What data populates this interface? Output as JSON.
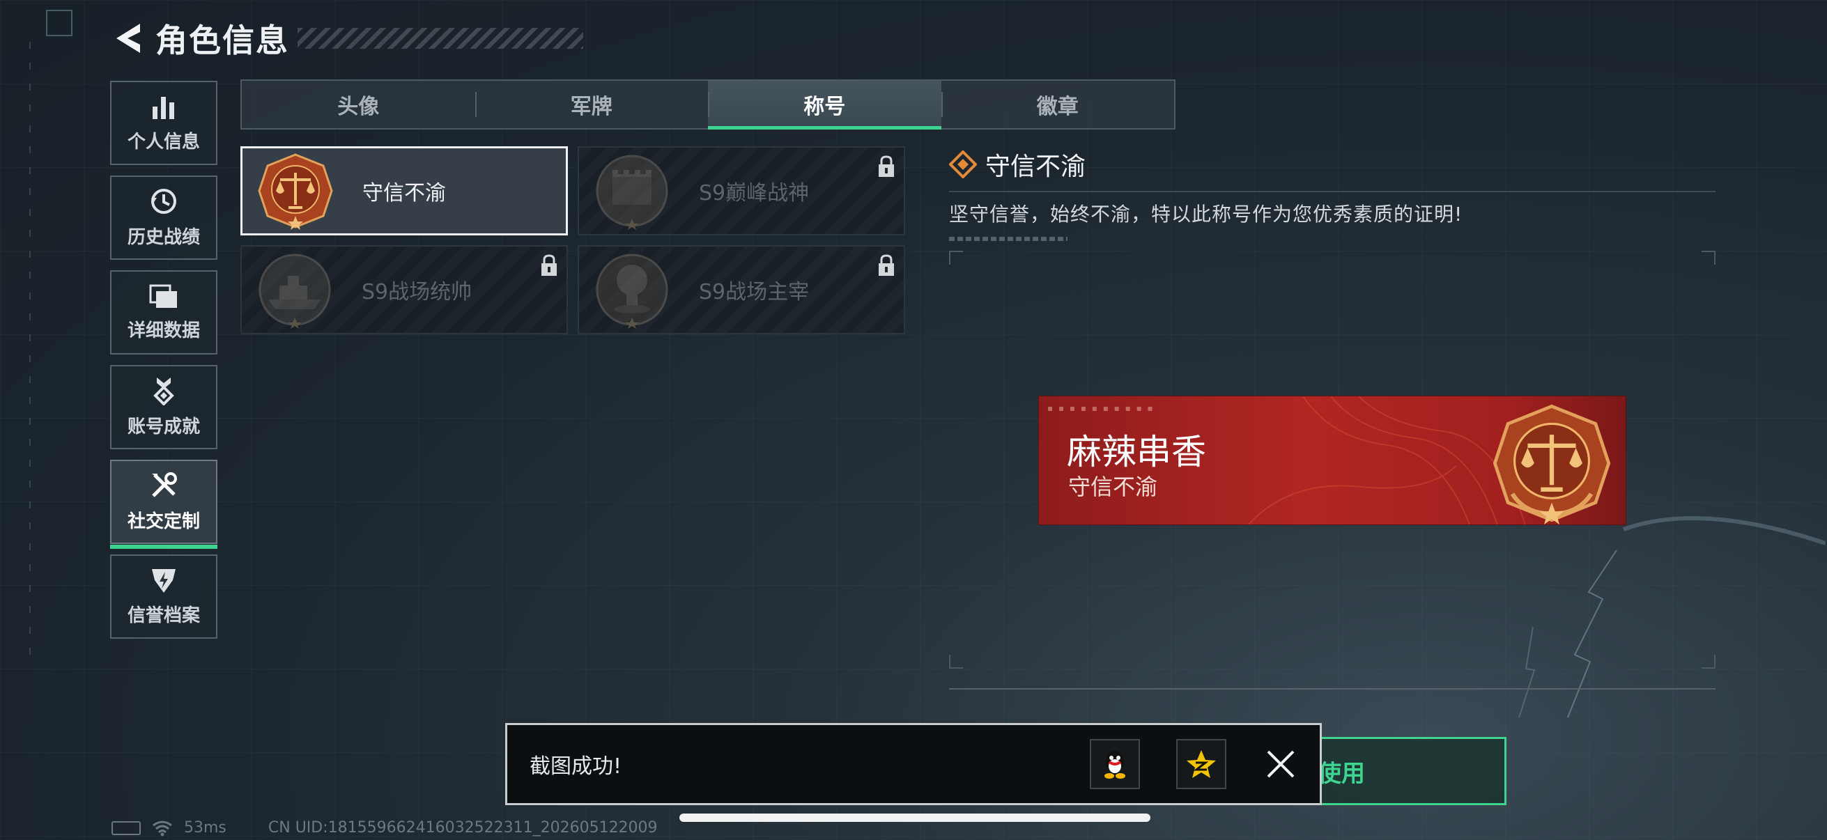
{
  "header": {
    "title": "角色信息"
  },
  "sidebar": {
    "items": [
      {
        "label": "个人信息",
        "icon": "bar-chart-icon"
      },
      {
        "label": "历史战绩",
        "icon": "history-clock-icon"
      },
      {
        "label": "详细数据",
        "icon": "folder-icon"
      },
      {
        "label": "账号成就",
        "icon": "achievement-medal-icon"
      },
      {
        "label": "社交定制",
        "icon": "tools-icon",
        "active": true
      },
      {
        "label": "信誉档案",
        "icon": "shield-bolt-icon"
      }
    ]
  },
  "tabs": [
    {
      "label": "头像"
    },
    {
      "label": "军牌"
    },
    {
      "label": "称号",
      "active": true
    },
    {
      "label": "徽章"
    }
  ],
  "titles": [
    {
      "name": "守信不渝",
      "selected": true,
      "locked": false,
      "medal": "scales-medal-icon"
    },
    {
      "name": "S9巅峰战神",
      "selected": false,
      "locked": true,
      "medal": "fortress-medal-icon"
    },
    {
      "name": "S9战场统帅",
      "selected": false,
      "locked": true,
      "medal": "warship-medal-icon"
    },
    {
      "name": "S9战场主宰",
      "selected": false,
      "locked": true,
      "medal": "explosion-medal-icon"
    }
  ],
  "detail": {
    "title": "守信不渝",
    "description": "坚守信誉，始终不渝，特以此称号作为您优秀素质的证明!"
  },
  "nameplate": {
    "player_name": "麻辣串香",
    "title": "守信不渝"
  },
  "use_button": {
    "label": "使用"
  },
  "toast": {
    "message": "截图成功!",
    "share_targets": [
      "qq-penguin-icon",
      "qzone-star-icon"
    ]
  },
  "status": {
    "ping": "53ms",
    "uid": "CN UID:18155966241603252​2311_202605122009"
  },
  "colors": {
    "accent_green": "#3ed38f",
    "plate_red": "#b02622",
    "medal_bronze": "#c0622a"
  }
}
